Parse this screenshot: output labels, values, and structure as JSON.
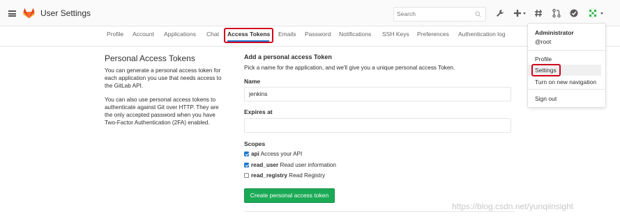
{
  "header": {
    "title": "User Settings",
    "search_placeholder": "Search",
    "icons": [
      "menu-icon",
      "gitlab-logo",
      "wrench-icon",
      "plus-icon",
      "hash-icon",
      "merge-request-icon",
      "check-circle-icon",
      "avatar"
    ]
  },
  "tabs": [
    {
      "label": "Profile",
      "active": false
    },
    {
      "label": "Account",
      "active": false
    },
    {
      "label": "Applications",
      "active": false
    },
    {
      "label": "Chat",
      "active": false
    },
    {
      "label": "Access Tokens",
      "active": true
    },
    {
      "label": "Emails",
      "active": false
    },
    {
      "label": "Password",
      "active": false
    },
    {
      "label": "Notifications",
      "active": false
    },
    {
      "label": "SSH Keys",
      "active": false
    },
    {
      "label": "Preferences",
      "active": false
    },
    {
      "label": "Authentication log",
      "active": false
    }
  ],
  "left": {
    "title": "Personal Access Tokens",
    "p1_l1": "You can generate a personal access token for",
    "p1_l2": "each application you use that needs access to",
    "p1_l3": "the GitLab API.",
    "p2_l1": "You can also use personal access tokens to",
    "p2_l2": "authenticate against Git over HTTP. They are",
    "p2_l3": "the only accepted password when you have",
    "p2_l4": "Two-Factor Authentication (2FA) enabled."
  },
  "form": {
    "title": "Add a personal access Token",
    "description": "Pick a name for the application, and we'll give you a unique personal access Token.",
    "name_label": "Name",
    "name_value": "jenkins",
    "expires_label": "Expires at",
    "expires_value": "",
    "scopes_label": "Scopes",
    "scopes": [
      {
        "name": "api",
        "desc": "Access your API",
        "checked": true
      },
      {
        "name": "read_user",
        "desc": "Read user information",
        "checked": true
      },
      {
        "name": "read_registry",
        "desc": "Read Registry",
        "checked": false
      }
    ],
    "submit_label": "Create personal access token"
  },
  "dropdown": {
    "name": "Administrator",
    "username": "@root",
    "items": [
      "Profile",
      "Settings",
      "Turn on new navigation",
      "Sign out"
    ]
  },
  "watermark": "https://blog.csdn.net/yunqiinsight",
  "colors": {
    "accent_blue": "#1f78d1",
    "success_green": "#1aaa55",
    "highlight_red": "#d0021b"
  }
}
